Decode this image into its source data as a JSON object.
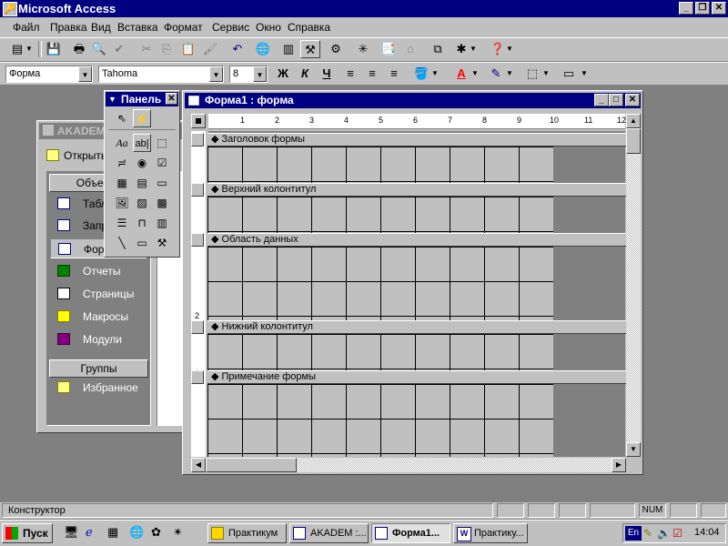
{
  "app": {
    "title": "Microsoft Access"
  },
  "menu": [
    "Файл",
    "Правка",
    "Вид",
    "Вставка",
    "Формат",
    "Сервис",
    "Окно",
    "Справка"
  ],
  "format_toolbar": {
    "object": "Форма",
    "font": "Tahoma",
    "size": "8",
    "bold": "Ж",
    "italic": "К",
    "underline": "Ч"
  },
  "db_window": {
    "title": "AKADEM",
    "open_button": "Открыть",
    "objects_label": "Объекты",
    "items": [
      "Табл",
      "Запр",
      "Фор",
      "Отчеты",
      "Страницы",
      "Макросы",
      "Модули"
    ],
    "groups_label": "Группы",
    "groups": [
      "Избранное"
    ]
  },
  "toolbox": {
    "title": "Панель",
    "label_tool": "Aa",
    "textbox_tool": "ab|"
  },
  "form_window": {
    "title": "Форма1 : форма",
    "ruler": [
      "1",
      "2",
      "3",
      "4",
      "5",
      "6",
      "7",
      "8",
      "9",
      "10",
      "11",
      "12"
    ],
    "vruler_nums": [
      "1",
      "2"
    ],
    "sections": [
      "Заголовок формы",
      "Верхний колонтитул",
      "Область данных",
      "Нижний колонтитул",
      "Примечание формы"
    ]
  },
  "status": {
    "text": "Конструктор",
    "num": "NUM"
  },
  "taskbar": {
    "start": "Пуск",
    "tasks": [
      "Практикум",
      "AKADEM :...",
      "Форма1...",
      "Практику..."
    ],
    "lang": "En",
    "time": "14:04"
  }
}
